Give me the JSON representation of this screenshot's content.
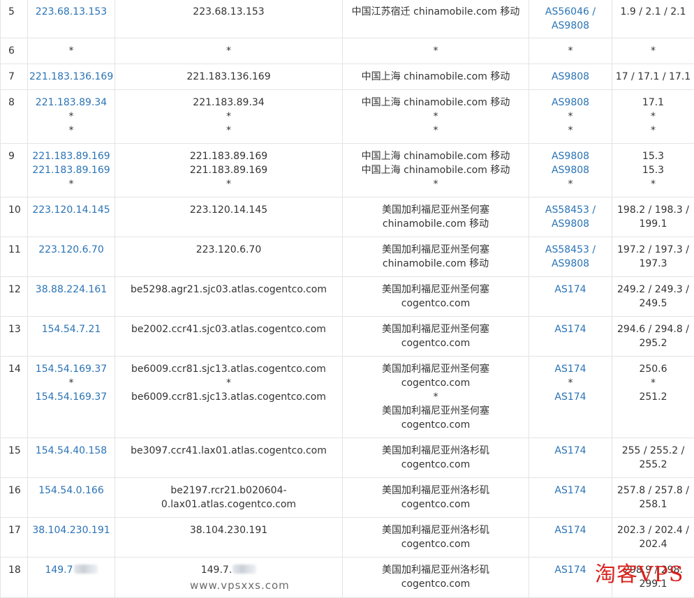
{
  "table": {
    "rows": [
      {
        "hop": "5",
        "ip": [
          "223.68.13.153"
        ],
        "host": [
          "223.68.13.153"
        ],
        "location": [
          "中国江苏宿迁 chinamobile.com 移动"
        ],
        "asn": [
          "AS56046 /",
          "AS9808"
        ],
        "latency": [
          "1.9 / 2.1 / 2.1"
        ]
      },
      {
        "hop": "6",
        "ip": [
          "*"
        ],
        "host": [
          "*"
        ],
        "location": [
          "*"
        ],
        "asn": [
          "*"
        ],
        "latency": [
          "*"
        ]
      },
      {
        "hop": "7",
        "ip": [
          "221.183.136.169"
        ],
        "host": [
          "221.183.136.169"
        ],
        "location": [
          "中国上海 chinamobile.com 移动"
        ],
        "asn": [
          "AS9808"
        ],
        "latency": [
          "17 / 17.1 / 17.1"
        ]
      },
      {
        "hop": "8",
        "ip": [
          "221.183.89.34",
          "*",
          "*"
        ],
        "host": [
          "221.183.89.34",
          "*",
          "*"
        ],
        "location": [
          "中国上海 chinamobile.com 移动",
          "*",
          "*"
        ],
        "asn": [
          "AS9808",
          "*",
          "*"
        ],
        "latency": [
          "17.1",
          "*",
          "*"
        ]
      },
      {
        "hop": "9",
        "ip": [
          "221.183.89.169",
          "221.183.89.169",
          "*"
        ],
        "host": [
          "221.183.89.169",
          "221.183.89.169",
          "*"
        ],
        "location": [
          "中国上海 chinamobile.com 移动",
          "中国上海 chinamobile.com 移动",
          "*"
        ],
        "asn": [
          "AS9808",
          "AS9808",
          "*"
        ],
        "latency": [
          "15.3",
          "15.3",
          "*"
        ]
      },
      {
        "hop": "10",
        "ip": [
          "223.120.14.145"
        ],
        "host": [
          "223.120.14.145"
        ],
        "location": [
          "美国加利福尼亚州圣何塞",
          "chinamobile.com 移动"
        ],
        "asn": [
          "AS58453 /",
          "AS9808"
        ],
        "latency": [
          "198.2 / 198.3 /",
          "199.1"
        ]
      },
      {
        "hop": "11",
        "ip": [
          "223.120.6.70"
        ],
        "host": [
          "223.120.6.70"
        ],
        "location": [
          "美国加利福尼亚州圣何塞",
          "chinamobile.com 移动"
        ],
        "asn": [
          "AS58453 /",
          "AS9808"
        ],
        "latency": [
          "197.2 / 197.3 /",
          "197.3"
        ]
      },
      {
        "hop": "12",
        "ip": [
          "38.88.224.161"
        ],
        "host": [
          "be5298.agr21.sjc03.atlas.cogentco.com"
        ],
        "location": [
          "美国加利福尼亚州圣何塞",
          "cogentco.com"
        ],
        "asn": [
          "AS174"
        ],
        "latency": [
          "249.2 / 249.3 /",
          "249.5"
        ]
      },
      {
        "hop": "13",
        "ip": [
          "154.54.7.21"
        ],
        "host": [
          "be2002.ccr41.sjc03.atlas.cogentco.com"
        ],
        "location": [
          "美国加利福尼亚州圣何塞",
          "cogentco.com"
        ],
        "asn": [
          "AS174"
        ],
        "latency": [
          "294.6 / 294.8 /",
          "295.2"
        ]
      },
      {
        "hop": "14",
        "ip": [
          "154.54.169.37",
          "*",
          "154.54.169.37"
        ],
        "host": [
          "be6009.ccr81.sjc13.atlas.cogentco.com",
          "*",
          "be6009.ccr81.sjc13.atlas.cogentco.com"
        ],
        "location": [
          "美国加利福尼亚州圣何塞",
          "cogentco.com",
          "*",
          "美国加利福尼亚州圣何塞",
          "cogentco.com"
        ],
        "asn": [
          "AS174",
          "*",
          "AS174"
        ],
        "latency": [
          "250.6",
          "*",
          "251.2"
        ]
      },
      {
        "hop": "15",
        "ip": [
          "154.54.40.158"
        ],
        "host": [
          "be3097.ccr41.lax01.atlas.cogentco.com"
        ],
        "location": [
          "美国加利福尼亚州洛杉矶",
          "cogentco.com"
        ],
        "asn": [
          "AS174"
        ],
        "latency": [
          "255 / 255.2 /",
          "255.2"
        ]
      },
      {
        "hop": "16",
        "ip": [
          "154.54.0.166"
        ],
        "host": [
          "be2197.rcr21.b020604-",
          "0.lax01.atlas.cogentco.com"
        ],
        "location": [
          "美国加利福尼亚州洛杉矶",
          "cogentco.com"
        ],
        "asn": [
          "AS174"
        ],
        "latency": [
          "257.8 / 257.8 /",
          "258.1"
        ]
      },
      {
        "hop": "17",
        "ip": [
          "38.104.230.191"
        ],
        "host": [
          "38.104.230.191"
        ],
        "location": [
          "美国加利福尼亚州洛杉矶",
          "cogentco.com"
        ],
        "asn": [
          "AS174"
        ],
        "latency": [
          "202.3 / 202.4 /",
          "202.4"
        ]
      },
      {
        "hop": "18",
        "ip": [
          "149.7"
        ],
        "host": [
          "149.7."
        ],
        "location": [
          "美国加利福尼亚州洛杉矶",
          "cogentco.com"
        ],
        "asn": [
          "AS174"
        ],
        "latency": [
          "298.9 / 298.",
          "299.1"
        ]
      }
    ]
  },
  "watermark": {
    "url": "www.vpsxxs.com",
    "logo": "淘客VPS"
  },
  "colors": {
    "link": "#2a73b5",
    "text": "#333333",
    "border": "#e4e4e4",
    "logo": "#d9221c"
  }
}
